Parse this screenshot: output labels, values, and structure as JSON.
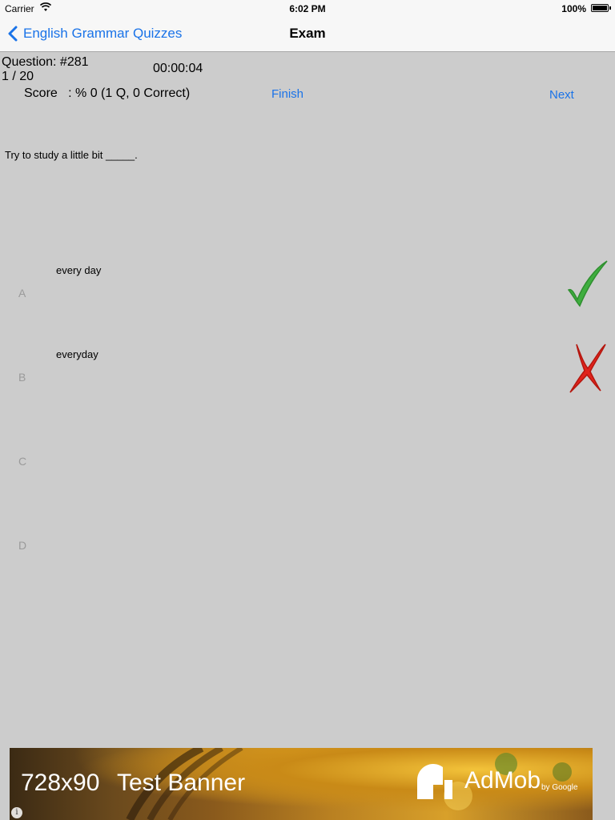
{
  "status_bar": {
    "carrier": "Carrier",
    "time": "6:02 PM",
    "battery": "100%"
  },
  "nav": {
    "back_label": "English Grammar Quizzes",
    "title": "Exam"
  },
  "quiz": {
    "question_number": "Question: #281",
    "progress": "1 / 20",
    "timer": "00:00:04",
    "score": "Score   : % 0 (1 Q, 0 Correct)",
    "finish_label": "Finish",
    "next_label": "Next",
    "question_text": "Try to study a little bit _____."
  },
  "answers": [
    {
      "letter": "A",
      "text": "every day",
      "mark": "check-icon"
    },
    {
      "letter": "B",
      "text": "everyday",
      "mark": "cross-icon"
    },
    {
      "letter": "C",
      "text": ""
    },
    {
      "letter": "D",
      "text": ""
    }
  ],
  "ad": {
    "size_label": "728x90",
    "test_label": "Test Banner",
    "brand": "AdMob",
    "brand_by": "by Google",
    "info_glyph": "i"
  },
  "colors": {
    "accent": "#1a73e8",
    "background": "#cccccc",
    "correct": "#3fae3f",
    "wrong": "#e0231c"
  }
}
